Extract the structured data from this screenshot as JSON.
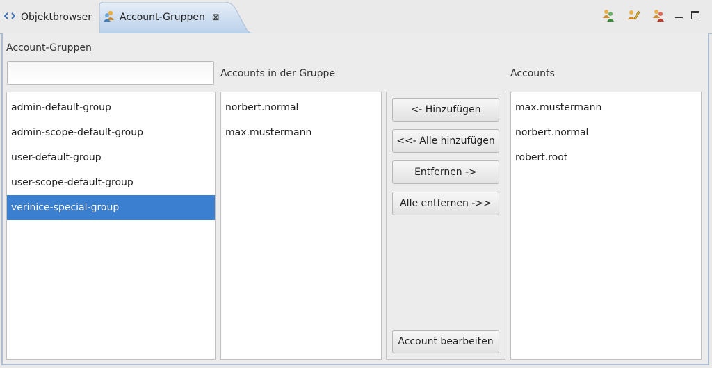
{
  "tabs": [
    {
      "label": "Objektbrowser",
      "icon": "code-brackets-icon",
      "active": false
    },
    {
      "label": "Account-Gruppen",
      "icon": "account-group-icon",
      "active": true
    }
  ],
  "tab_close_glyph": "⊠",
  "toolbar_icons": [
    "add-group-icon",
    "edit-group-icon",
    "delete-group-icon"
  ],
  "groups_panel": {
    "label": "Account-Gruppen",
    "filter_value": "",
    "items": [
      {
        "label": "admin-default-group",
        "selected": false
      },
      {
        "label": "admin-scope-default-group",
        "selected": false
      },
      {
        "label": "user-default-group",
        "selected": false
      },
      {
        "label": "user-scope-default-group",
        "selected": false
      },
      {
        "label": "verinice-special-group",
        "selected": true
      }
    ]
  },
  "members_panel": {
    "label": "Accounts in der Gruppe",
    "items": [
      "norbert.normal",
      "max.mustermann"
    ]
  },
  "buttons": {
    "add": "<- Hinzufügen",
    "add_all": "<<- Alle hinzufügen",
    "remove": "Entfernen ->",
    "remove_all": "Alle entfernen ->>",
    "edit_account": "Account bearbeiten"
  },
  "accounts_panel": {
    "label": "Accounts",
    "items": [
      "max.mustermann",
      "norbert.normal",
      "robert.root"
    ]
  },
  "colors": {
    "selection": "#3b7fd0",
    "active_tab": "#c5d9ee",
    "frame_border": "#a9bed3"
  }
}
